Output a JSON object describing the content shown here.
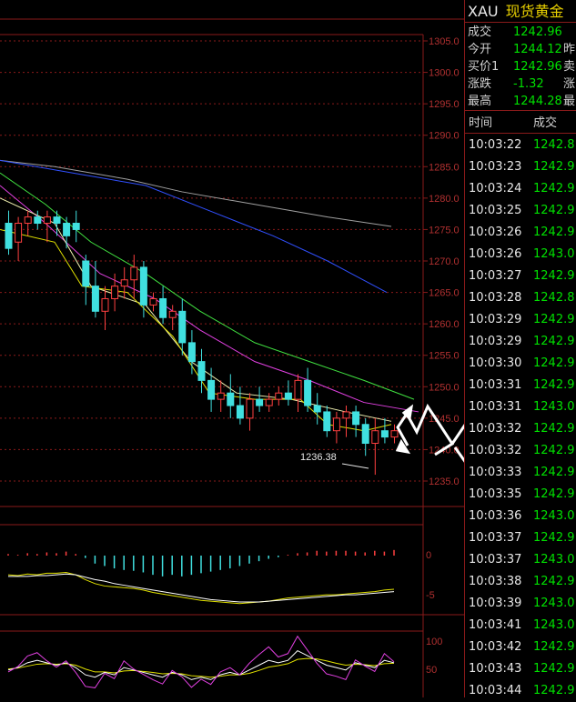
{
  "chart": {
    "price_axis": [
      "1305.0",
      "1300.0",
      "1295.0",
      "1290.0",
      "1285.0",
      "1280.0",
      "1275.0",
      "1270.0",
      "1265.0",
      "1260.0",
      "1255.0",
      "1250.0",
      "1245.0",
      "1240.0",
      "1235.0"
    ],
    "low_annotation": "1236.38",
    "macd_axis": [
      "0",
      "-5"
    ],
    "kdj_axis": [
      "100",
      "50",
      "0"
    ],
    "colors": {
      "grid": "#8a1a1a",
      "up": "#ff4040",
      "down": "#40e0e0",
      "ma_white": "#f0f0b0",
      "ma_yellow": "#e0e000",
      "ma_magenta": "#e040e0",
      "ma_green": "#40e040",
      "ma_blue": "#3050ff",
      "ma_gray": "#a0a0a0"
    }
  },
  "quote": {
    "symbol": "XAU",
    "name": "现货黄金",
    "rows": [
      {
        "label": "成交",
        "value": "1242.96",
        "cut": ""
      },
      {
        "label": "今开",
        "value": "1244.12",
        "cut": "昨"
      },
      {
        "label": "买价1",
        "value": "1242.96",
        "cut": "卖"
      },
      {
        "label": "涨跌",
        "value": "-1.32",
        "cut": "涨"
      },
      {
        "label": "最高",
        "value": "1244.28",
        "cut": "最"
      }
    ],
    "ticks_header": {
      "time": "时间",
      "price": "成交"
    },
    "ticks": [
      {
        "time": "10:03:22",
        "price": "1242.8"
      },
      {
        "time": "10:03:23",
        "price": "1242.9"
      },
      {
        "time": "10:03:24",
        "price": "1242.9"
      },
      {
        "time": "10:03:25",
        "price": "1242.9"
      },
      {
        "time": "10:03:26",
        "price": "1242.9"
      },
      {
        "time": "10:03:26",
        "price": "1243.0"
      },
      {
        "time": "10:03:27",
        "price": "1242.9"
      },
      {
        "time": "10:03:28",
        "price": "1242.8"
      },
      {
        "time": "10:03:29",
        "price": "1242.9"
      },
      {
        "time": "10:03:29",
        "price": "1242.9"
      },
      {
        "time": "10:03:30",
        "price": "1242.9"
      },
      {
        "time": "10:03:31",
        "price": "1242.9"
      },
      {
        "time": "10:03:31",
        "price": "1243.0"
      },
      {
        "time": "10:03:32",
        "price": "1242.9"
      },
      {
        "time": "10:03:32",
        "price": "1242.9"
      },
      {
        "time": "10:03:33",
        "price": "1242.9"
      },
      {
        "time": "10:03:35",
        "price": "1242.9"
      },
      {
        "time": "10:03:36",
        "price": "1243.0"
      },
      {
        "time": "10:03:37",
        "price": "1242.9"
      },
      {
        "time": "10:03:37",
        "price": "1243.0"
      },
      {
        "time": "10:03:38",
        "price": "1242.9"
      },
      {
        "time": "10:03:39",
        "price": "1243.0"
      },
      {
        "time": "10:03:41",
        "price": "1243.0"
      },
      {
        "time": "10:03:42",
        "price": "1242.9"
      },
      {
        "time": "10:03:43",
        "price": "1242.9"
      },
      {
        "time": "10:03:44",
        "price": "1242.9"
      }
    ]
  }
}
